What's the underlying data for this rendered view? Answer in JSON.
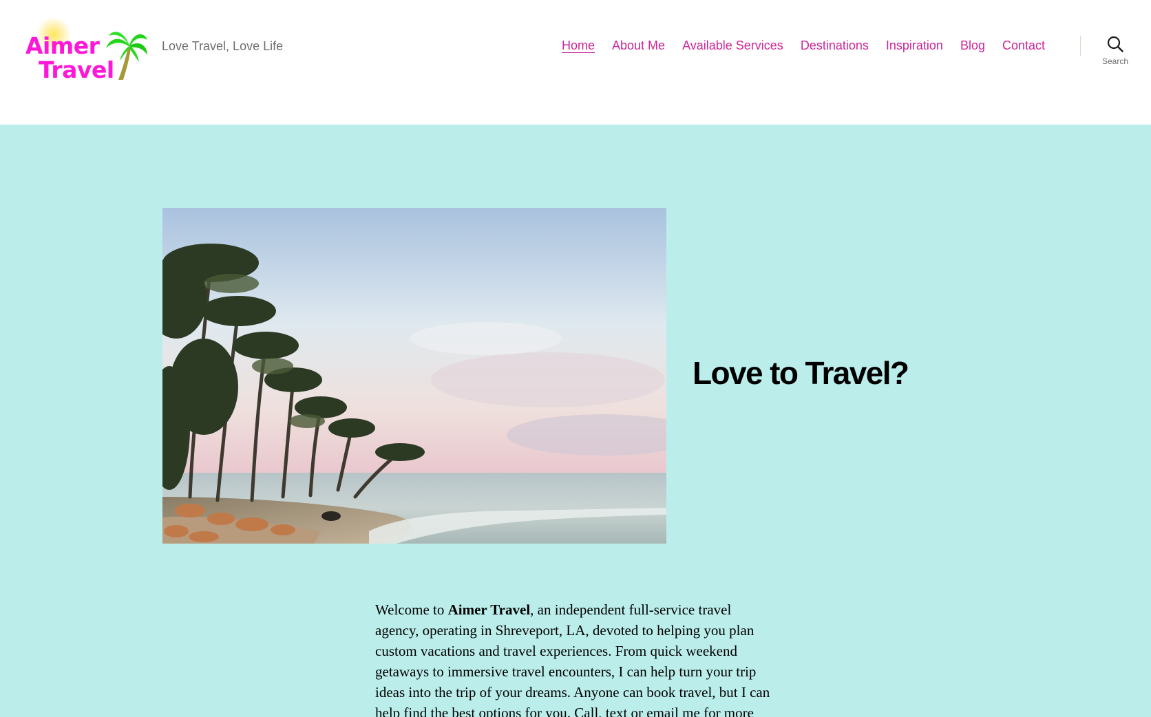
{
  "header": {
    "logo": {
      "line1": "Aimer",
      "line2": "Travel"
    },
    "tagline": "Love Travel, Love Life",
    "nav": [
      {
        "label": "Home",
        "active": true
      },
      {
        "label": "About Me",
        "active": false
      },
      {
        "label": "Available Services",
        "active": false
      },
      {
        "label": "Destinations",
        "active": false
      },
      {
        "label": "Inspiration",
        "active": false
      },
      {
        "label": "Blog",
        "active": false
      },
      {
        "label": "Contact",
        "active": false
      }
    ],
    "search_label": "Search"
  },
  "hero": {
    "heading": "Love to Travel?",
    "image_icon": "beach-palm-trees-photo"
  },
  "intro": {
    "before": "Welcome to ",
    "bold": "Aimer Travel",
    "after": ", an independent full-service travel agency, operating in Shreveport, LA, devoted to helping you plan custom vacations and travel experiences. From quick weekend getaways to immersive travel encounters, I can help turn your trip ideas into the trip of your dreams. Anyone can book travel, but I can help find the best options for you. Call, text or email me for more"
  },
  "colors": {
    "accent": "#cd2697",
    "logo_pink": "#ff17d8",
    "background_cyan": "#bbeeeb",
    "tagline_gray": "#6d6d6d"
  }
}
